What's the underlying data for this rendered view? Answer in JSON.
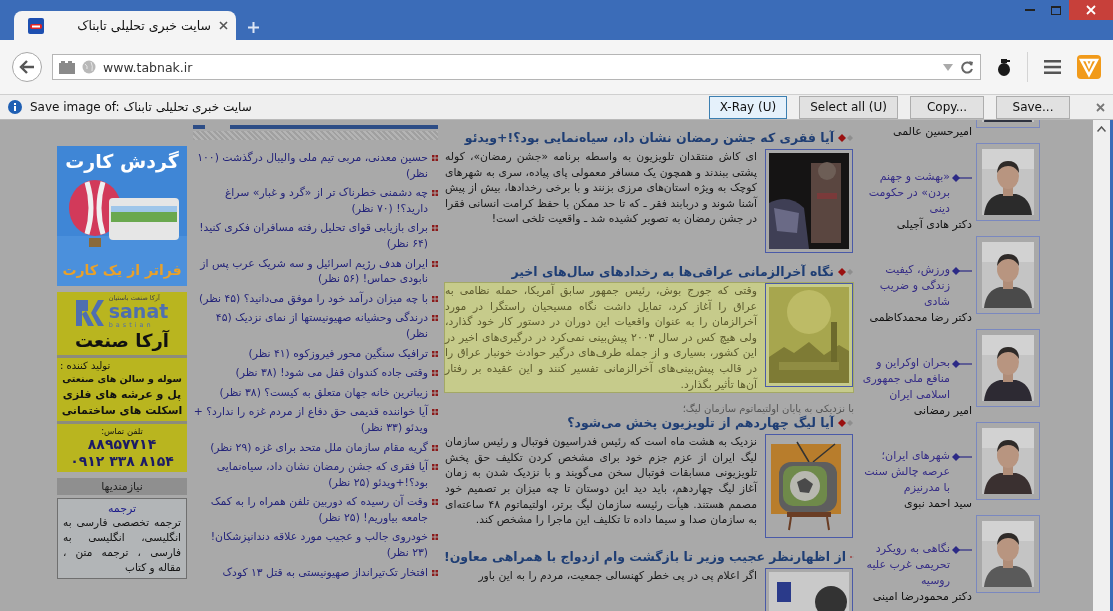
{
  "tabs": [
    {
      "title": "سایت خبری تحلیلی تابناک",
      "selected": true
    }
  ],
  "toolbar": {
    "url": "www.tabnak.ir"
  },
  "info_bar": {
    "message": "Save image of: سایت خبری تحلیلی تابناک",
    "xray_button": {
      "label": "X-Ray (U)",
      "selected": true
    },
    "select_all_button": {
      "label": "Select all (U)",
      "selected": false
    },
    "copy_button": {
      "label": "Copy...",
      "selected": false
    },
    "save_button": {
      "label": "Save...",
      "selected": false
    }
  },
  "ads": [
    {
      "kind": "picture_ad",
      "headline": "گردش کارت",
      "tagline": "فراتر از یک کارت"
    },
    {
      "kind": "text_ad",
      "logo_caption": "آرکا صنعت باستیان",
      "logo_word": "sanat",
      "logo_sub": "bastian",
      "name": "آرکا صنعت",
      "intro": "تولید کننده :",
      "lines": [
        "سوله و سالن های صنعتی",
        "پل و عرشه های فلزی",
        "اسکلت های ساختمانی"
      ],
      "phone_label": "تلفن تماس:",
      "phones": [
        "۸۸۹۵۷۷۱۴",
        "۰۹۱۲ ۳۳۸ ۸۱۵۴"
      ]
    }
  ],
  "classifieds": {
    "title": "نیازمندیها",
    "heading": "ترجمه",
    "text": "ترجمه تخصصی فارسی به انگلیسی، انگلیسی به فارسی ، ترجمه متن ، مقاله و کتاب"
  },
  "most_commented": [
    "حسین معدنی، مربی تیم ملی والیبال درگذشت (۱۰۰ نظر)",
    "چه دشمنی خطرناک تر از «گرد و غبار» سراغ دارید؟! (۷۰ نظر)",
    "برای بازیابی قوای تحلیل رفته مسافران فکری کنید! (۶۴ نظر)",
    "ایران هدف رژیم اسرائیل و سه شریک عرب پس از نابودی حماس! (۵۶ نظر)",
    "با چه میزان درآمد خود را موفق می‌دانید؟ (۴۵ نظر)",
    "درندگی وحشیانه صهیونیستها از نمای نزدیک (۴۵ نظر)",
    "ترافیک سنگین محور فیروزکوه (۴۱ نظر)",
    "وقتی جاده کندوان قفل می شود! (۳۸ نظر)",
    "زیباترین خانه جهان متعلق به کیست؟ (۳۸ نظر)",
    "آیا خواننده قدیمی حق دفاع از مردم غزه را ندارد؟ + ویدئو (۳۳ نظر)",
    "گریه مقام سازمان ملل متحد برای غزه (۲۹ نظر)",
    "آیا فقری که جشن رمضان نشان داد، سیاه‌نمایی بود؟!+ویدئو (۲۵ نظر)",
    "وقت آن رسیده که دوربین تلفن همراه را به کمک جامعه بیاوریم! (۲۵ نظر)",
    "خودروی جالب و عجیب مورد علاقه دندانپزشکان! (۲۳ نظر)",
    "افتخار تک‌تیرانداز صهیونیستی به قتل ۱۳ کودک"
  ],
  "articles": [
    {
      "title": "آیا فقری که جشن رمضان نشان داد، سیاه‌نمایی بود؟!+ویدئو",
      "body": "ای کاش منتقدان تلویزیون به واسطه برنامه «جشن رمضان»، کوله پشتی ببندند و همچون یک مسافر معمولی پای پیاده، سری به شهرهای کوچک به ویژه استان‌های مرزی بزنند و با برخی رخدادها، بیش از پیش آشنا شوند و دربابند فقر ـ که تا حد ممکن با حفظ کرامت انسانی فقرا در جشن رمضان به تصویر کشیده شد ـ واقعیت تلخی است!",
      "selected": false
    },
    {
      "title": "نگاه آخرالزمانی عراقی‌ها به رخدادهای سال‌های اخیر",
      "body": "وقتی که جورج بوش، رئیس جمهور سابق آمریکا، حمله نظامی به عراق را آغاز کرد، تمایل داشت نگاه مسیحیان راستگرا در مورد آخرالزمان را به عنوان واقعیات این دوران در دستور کار خود گذارد، ولی هیچ کس در سال ۲۰۰۳ پیش‌بینی نمی‌کرد در درگیری‌های اخیر در این کشور، بسیاری و از جمله طرف‌های درگیر حوادث خونبار عراق را در قالب پیش‌بینی‌های آخرالزمانی تفسیر کنند و این عقیده بر رفتار آن‌ها تأثیر بگذارد.",
      "selected": true
    },
    {
      "kicker": "با نزدیکی به پایان اولتیماتوم سازمان لیگ؛",
      "title": "آیا لیگ چهاردهم از تلویزیون پخش می‌شود؟",
      "body": "نزدیک به هشت ماه است که رئیس فدراسیون فوتبال و رئیس سازمان لیگ ایران از عزم جزم خود برای مشخص کردن تکلیف حق پخش تلویزیونی مسابقات فوتبال سخن می‌گویند و با نزدیک شدن به زمان آغاز لیگ چهاردهم، باید دید این دوستان تا چه میزان بر تصمیم خود مصمم هستند. هیأت رئیسه سازمان لیگ برتر، اولتیماتوم ۴۸ ساعته‌ای به سازمان صدا و سیما داده تا تکلیف این ماجرا را مشخص کند.",
      "selected": false
    },
    {
      "title": "از اظهارنظر عجیب وزیر تا بازگشت وام ازدواج با همراهی معاون!",
      "body": "اگر اعلام پی در پی خطر کهنسالی جمعیت، مردم را به این باور",
      "selected": false
    }
  ],
  "columnists": [
    {
      "author": "امیرحسین عالمی"
    },
    {
      "title": "«بهشت و جهنم بردن» در حکومت دینی",
      "author": "دکتر هادی آجیلی"
    },
    {
      "title": "ورزش، کیفیت زندگی و ضریب شادی",
      "author": "دکتر رضا محمدکاظمی"
    },
    {
      "title": "بحران اوکراین و منافع ملی جمهوری اسلامی ایران",
      "author": "امیر رمضانی"
    },
    {
      "title": "شهرهای ایران؛ عرصه چالش سنت با مدرنیزم",
      "author": "سید احمد نبوی"
    },
    {
      "title": "نگاهی به رویکرد تحریمی غرب علیه روسیه",
      "author": "دکتر محمودرضا امینی"
    }
  ]
}
